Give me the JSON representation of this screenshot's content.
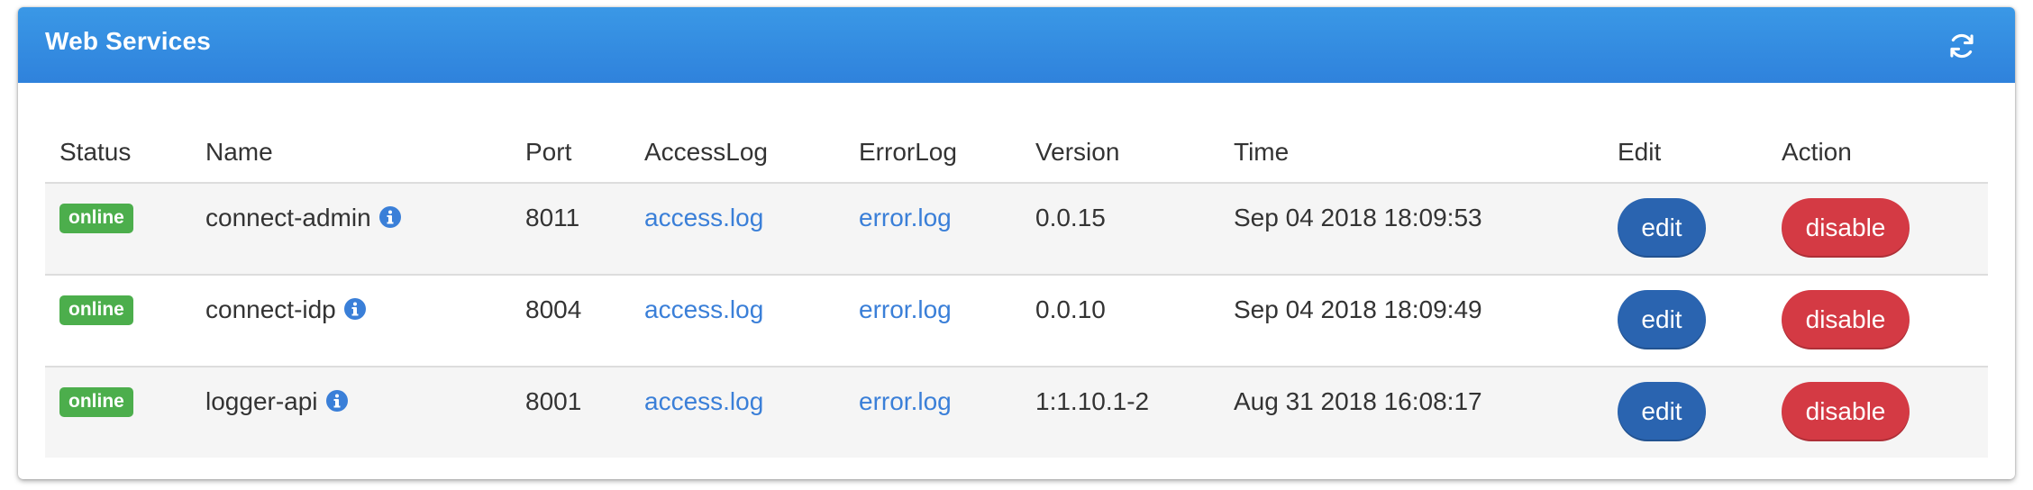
{
  "panel": {
    "title": "Web Services",
    "refresh_icon": "refresh-icon"
  },
  "table": {
    "headers": {
      "status": "Status",
      "name": "Name",
      "port": "Port",
      "access_log": "AccessLog",
      "error_log": "ErrorLog",
      "version": "Version",
      "time": "Time",
      "edit": "Edit",
      "action": "Action"
    },
    "rows": [
      {
        "status": "online",
        "name": "connect-admin",
        "port": "8011",
        "access_log": "access.log",
        "error_log": "error.log",
        "version": "0.0.15",
        "time": "Sep 04 2018 18:09:53",
        "edit_label": "edit",
        "action_label": "disable"
      },
      {
        "status": "online",
        "name": "connect-idp",
        "port": "8004",
        "access_log": "access.log",
        "error_log": "error.log",
        "version": "0.0.10",
        "time": "Sep 04 2018 18:09:49",
        "edit_label": "edit",
        "action_label": "disable"
      },
      {
        "status": "online",
        "name": "logger-api",
        "port": "8001",
        "access_log": "access.log",
        "error_log": "error.log",
        "version": "1:1.10.1-2",
        "time": "Aug 31 2018 16:08:17",
        "edit_label": "edit",
        "action_label": "disable"
      }
    ]
  },
  "colors": {
    "header_blue": "#3a98e6",
    "status_online": "#4cae4c",
    "link_blue": "#3a7fd8",
    "edit_button": "#2a64b0",
    "disable_button": "#d43a44",
    "info_icon": "#3a7fd8"
  }
}
